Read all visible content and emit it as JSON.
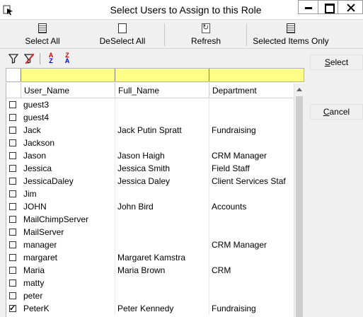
{
  "window": {
    "title": "Select Users to Assign to this Role"
  },
  "toolbar": {
    "select_all": "Select All",
    "deselect_all": "DeSelect All",
    "refresh": "Refresh",
    "selected_items_only": "Selected Items Only"
  },
  "side_buttons": {
    "select": "Select",
    "cancel": "Cancel"
  },
  "grid": {
    "columns": [
      "User_Name",
      "Full_Name",
      "Department"
    ],
    "rows": [
      {
        "user": "guest3",
        "full": "",
        "dept": "",
        "checked": false
      },
      {
        "user": "guest4",
        "full": "",
        "dept": "",
        "checked": false
      },
      {
        "user": "Jack",
        "full": "Jack Putin Spratt",
        "dept": "Fundraising",
        "checked": false
      },
      {
        "user": "Jackson",
        "full": "",
        "dept": "",
        "checked": false
      },
      {
        "user": "Jason",
        "full": "Jason Haigh",
        "dept": "CRM Manager",
        "checked": false
      },
      {
        "user": "Jessica",
        "full": "Jessica Smith",
        "dept": "Field Staff",
        "checked": false
      },
      {
        "user": "JessicaDaley",
        "full": "Jessica Daley",
        "dept": "Client Services Staf",
        "checked": false
      },
      {
        "user": "Jim",
        "full": "",
        "dept": "",
        "checked": false
      },
      {
        "user": "JOHN",
        "full": "John Bird",
        "dept": "Accounts",
        "checked": false
      },
      {
        "user": "MailChimpServer",
        "full": "",
        "dept": "",
        "checked": false
      },
      {
        "user": "MailServer",
        "full": "",
        "dept": "",
        "checked": false
      },
      {
        "user": "manager",
        "full": "",
        "dept": "CRM Manager",
        "checked": false
      },
      {
        "user": "margaret",
        "full": "Margaret Kamstra",
        "dept": "",
        "checked": false
      },
      {
        "user": "Maria",
        "full": "Maria Brown",
        "dept": "CRM",
        "checked": false
      },
      {
        "user": "matty",
        "full": "",
        "dept": "",
        "checked": false
      },
      {
        "user": "peter",
        "full": "",
        "dept": "",
        "checked": false
      },
      {
        "user": "PeterK",
        "full": "Peter Kennedy",
        "dept": "Fundraising",
        "checked": true
      }
    ]
  }
}
